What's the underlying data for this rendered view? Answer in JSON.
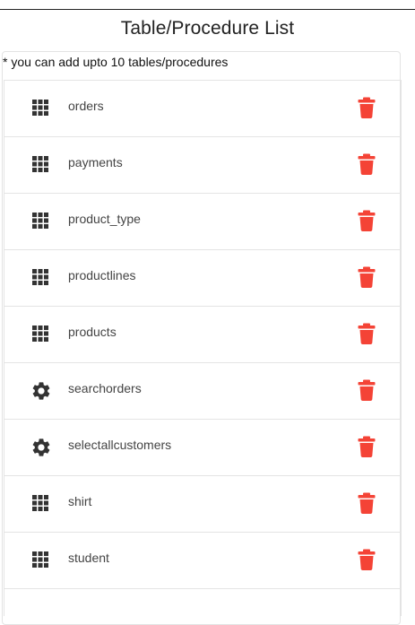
{
  "header": {
    "title": "Table/Procedure List"
  },
  "note": "* you can add upto 10 tables/procedures",
  "colors": {
    "trash": "#f44336",
    "icon": "#333333"
  },
  "items": [
    {
      "label": "orders",
      "kind": "table",
      "icon": "grid-icon"
    },
    {
      "label": "payments",
      "kind": "table",
      "icon": "grid-icon"
    },
    {
      "label": "product_type",
      "kind": "table",
      "icon": "grid-icon"
    },
    {
      "label": "productlines",
      "kind": "table",
      "icon": "grid-icon"
    },
    {
      "label": "products",
      "kind": "table",
      "icon": "grid-icon"
    },
    {
      "label": "searchorders",
      "kind": "procedure",
      "icon": "gear-icon"
    },
    {
      "label": "selectallcustomers",
      "kind": "procedure",
      "icon": "gear-icon"
    },
    {
      "label": "shirt",
      "kind": "table",
      "icon": "grid-icon"
    },
    {
      "label": "student",
      "kind": "table",
      "icon": "grid-icon"
    }
  ]
}
